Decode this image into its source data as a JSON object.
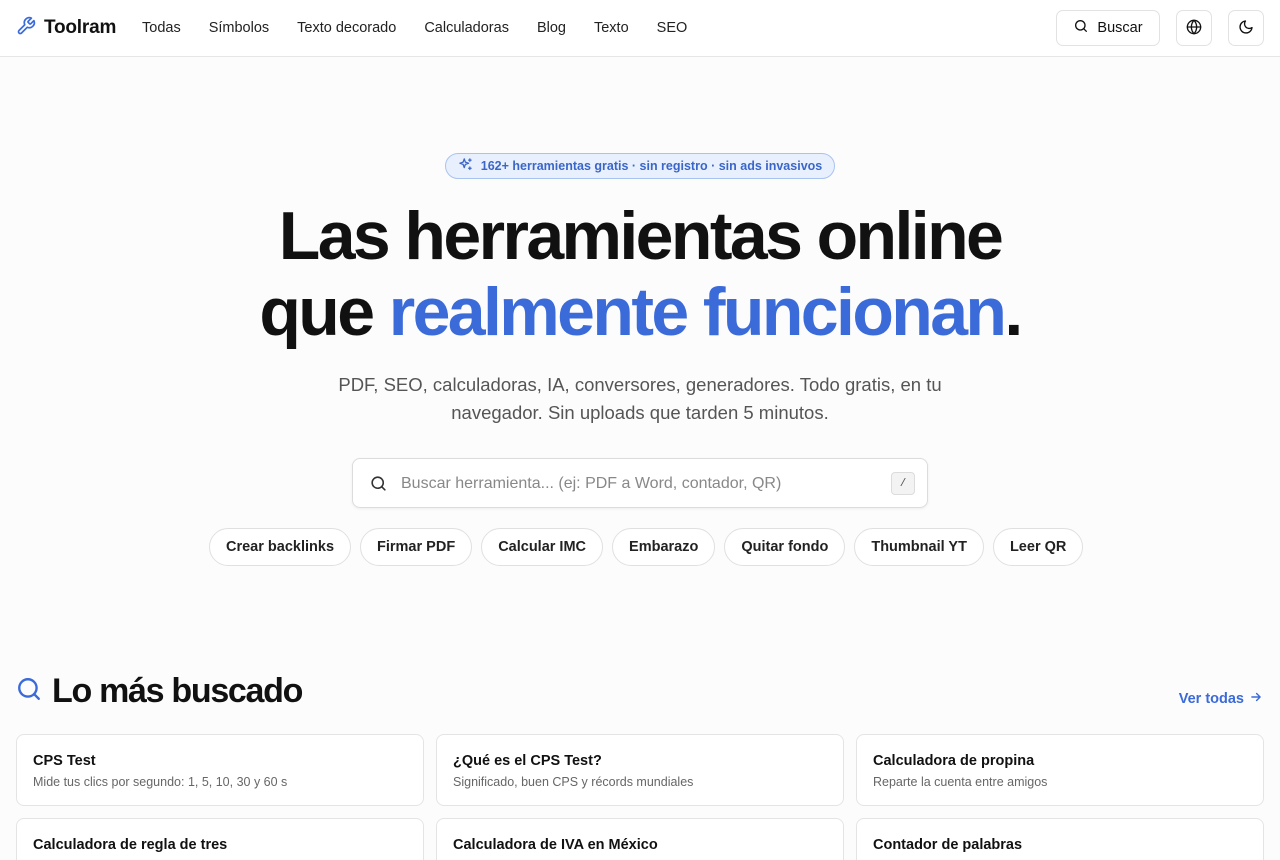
{
  "header": {
    "brand": "Toolram",
    "nav": [
      "Todas",
      "Símbolos",
      "Texto decorado",
      "Calculadoras",
      "Blog",
      "Texto",
      "SEO"
    ],
    "search_button": "Buscar"
  },
  "hero": {
    "badge": "162+ herramientas gratis · sin registro · sin ads invasivos",
    "title_line1": "Las herramientas online",
    "title_line2_start": "que ",
    "title_line2_accent": "realmente funcionan",
    "title_line2_end": ".",
    "subtitle": "PDF, SEO, calculadoras, IA, conversores, generadores. Todo gratis, en tu navegador. Sin uploads que tarden 5 minutos.",
    "search_placeholder": "Buscar herramienta... (ej: PDF a Word, contador, QR)",
    "search_value": "",
    "shortcut_key": "/",
    "quick_links": [
      "Crear backlinks",
      "Firmar PDF",
      "Calcular IMC",
      "Embarazo",
      "Quitar fondo",
      "Thumbnail YT",
      "Leer QR"
    ]
  },
  "popular": {
    "title": "Lo más buscado",
    "see_all": "Ver todas",
    "cards": [
      {
        "title": "CPS Test",
        "desc": "Mide tus clics por segundo: 1, 5, 10, 30 y 60 s"
      },
      {
        "title": "¿Qué es el CPS Test?",
        "desc": "Significado, buen CPS y récords mundiales"
      },
      {
        "title": "Calculadora de propina",
        "desc": "Reparte la cuenta entre amigos"
      },
      {
        "title": "Calculadora de regla de tres",
        "desc": ""
      },
      {
        "title": "Calculadora de IVA en México",
        "desc": ""
      },
      {
        "title": "Contador de palabras",
        "desc": ""
      }
    ]
  },
  "colors": {
    "accent": "#3b6bd9",
    "badge_bg": "#e8f0fd",
    "badge_border": "#a9c3f0",
    "text": "#111111"
  },
  "icons": {
    "logo": "wrench-icon",
    "search": "search-icon",
    "language": "globe-icon",
    "theme": "moon-icon",
    "badge": "sparkles-icon",
    "see_all": "arrow-right-icon"
  }
}
